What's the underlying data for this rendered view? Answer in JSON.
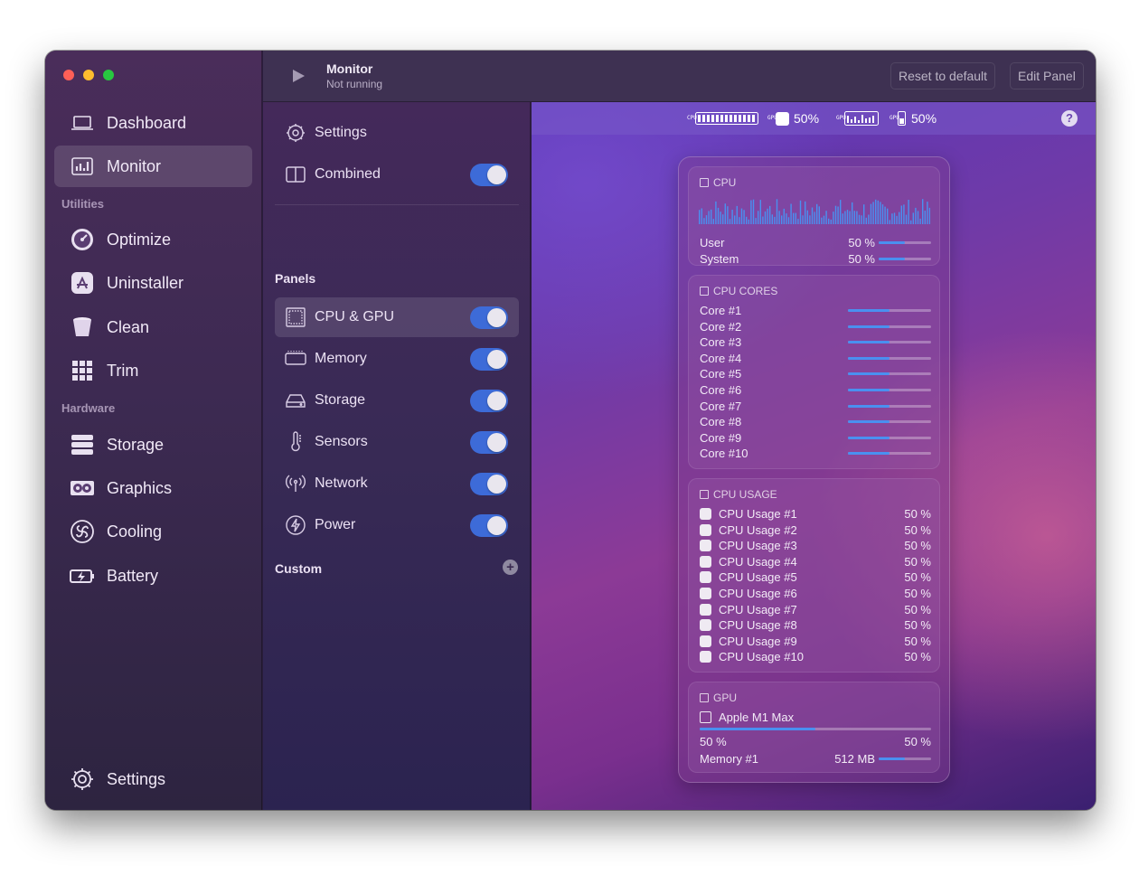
{
  "sidebar": {
    "items": [
      {
        "label": "Dashboard",
        "icon": "laptop-icon"
      },
      {
        "label": "Monitor",
        "icon": "chart-icon",
        "active": true
      }
    ],
    "sections": [
      {
        "label": "Utilities",
        "items": [
          {
            "label": "Optimize",
            "icon": "speedometer-icon"
          },
          {
            "label": "Uninstaller",
            "icon": "app-store-icon"
          },
          {
            "label": "Clean",
            "icon": "trash-icon"
          },
          {
            "label": "Trim",
            "icon": "grid-icon"
          }
        ]
      },
      {
        "label": "Hardware",
        "items": [
          {
            "label": "Storage",
            "icon": "server-icon"
          },
          {
            "label": "Graphics",
            "icon": "gpu-icon"
          },
          {
            "label": "Cooling",
            "icon": "fan-icon"
          },
          {
            "label": "Battery",
            "icon": "battery-icon"
          }
        ]
      }
    ],
    "settings_label": "Settings"
  },
  "header": {
    "title": "Monitor",
    "subtitle": "Not running",
    "reset_label": "Reset to default",
    "edit_label": "Edit Panel"
  },
  "middle": {
    "settings_label": "Settings",
    "combined_label": "Combined",
    "panels_label": "Panels",
    "panels": [
      {
        "label": "CPU & GPU",
        "icon": "cpu-icon",
        "enabled": true,
        "active": true
      },
      {
        "label": "Memory",
        "icon": "memory-icon",
        "enabled": true
      },
      {
        "label": "Storage",
        "icon": "drive-icon",
        "enabled": true
      },
      {
        "label": "Sensors",
        "icon": "thermometer-icon",
        "enabled": true
      },
      {
        "label": "Network",
        "icon": "antenna-icon",
        "enabled": true
      },
      {
        "label": "Power",
        "icon": "bolt-icon",
        "enabled": true
      }
    ],
    "custom_label": "Custom"
  },
  "menubar": {
    "cpu_tag": "CPU",
    "gpu_tag": "GPU",
    "gpu_value": "50%",
    "mem_tag": "GPU",
    "mem_value": "50%"
  },
  "cpu": {
    "title": "CPU",
    "user_label": "User",
    "user_value": "50 %",
    "user_fraction": 0.5,
    "system_label": "System",
    "system_value": "50 %",
    "system_fraction": 0.5
  },
  "cores": {
    "title": "CPU CORES",
    "items": [
      {
        "label": "Core #1",
        "fraction": 0.5
      },
      {
        "label": "Core #2",
        "fraction": 0.5
      },
      {
        "label": "Core #3",
        "fraction": 0.5
      },
      {
        "label": "Core #4",
        "fraction": 0.5
      },
      {
        "label": "Core #5",
        "fraction": 0.5
      },
      {
        "label": "Core #6",
        "fraction": 0.5
      },
      {
        "label": "Core #7",
        "fraction": 0.5
      },
      {
        "label": "Core #8",
        "fraction": 0.5
      },
      {
        "label": "Core #9",
        "fraction": 0.5
      },
      {
        "label": "Core #10",
        "fraction": 0.5
      }
    ]
  },
  "usage": {
    "title": "CPU USAGE",
    "items": [
      {
        "label": "CPU Usage #1",
        "value": "50 %"
      },
      {
        "label": "CPU Usage #2",
        "value": "50 %"
      },
      {
        "label": "CPU Usage #3",
        "value": "50 %"
      },
      {
        "label": "CPU Usage #4",
        "value": "50 %"
      },
      {
        "label": "CPU Usage #5",
        "value": "50 %"
      },
      {
        "label": "CPU Usage #6",
        "value": "50 %"
      },
      {
        "label": "CPU Usage #7",
        "value": "50 %"
      },
      {
        "label": "CPU Usage #8",
        "value": "50 %"
      },
      {
        "label": "CPU Usage #9",
        "value": "50 %"
      },
      {
        "label": "CPU Usage #10",
        "value": "50 %"
      }
    ]
  },
  "gpu": {
    "title": "GPU",
    "name": "Apple M1 Max",
    "fraction": 0.5,
    "left_value": "50 %",
    "right_value": "50 %",
    "memory_label": "Memory #1",
    "memory_value": "512 MB",
    "memory_fraction": 0.5
  },
  "colors": {
    "accent": "#3d6bd8",
    "bar_fill": "#4a90f0"
  }
}
